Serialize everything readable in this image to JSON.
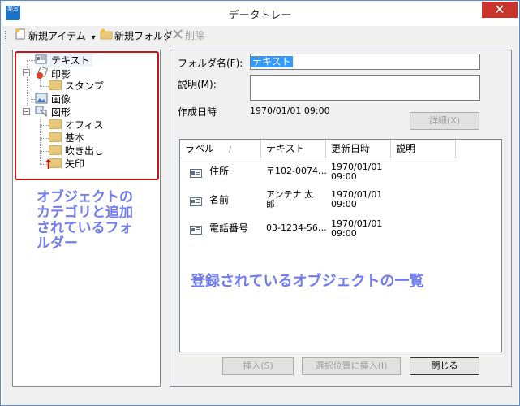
{
  "window": {
    "title": "データトレー",
    "close_glyph": "✕",
    "app_icon_text": "楽写"
  },
  "toolbar": {
    "new_item": "新規アイテム",
    "new_item_dropdown": "▾",
    "new_folder": "新規フォルダ",
    "delete": "削除"
  },
  "tree": {
    "items": [
      {
        "label": "テキスト",
        "icon": "text-icon"
      },
      {
        "label": "印影",
        "icon": "stamp-icon"
      },
      {
        "label": "スタンプ",
        "icon": "folder-icon"
      },
      {
        "label": "画像",
        "icon": "image-icon"
      },
      {
        "label": "図形",
        "icon": "shape-icon"
      },
      {
        "label": "オフィス",
        "icon": "folder-icon"
      },
      {
        "label": "基本",
        "icon": "folder-icon"
      },
      {
        "label": "吹き出し",
        "icon": "folder-icon"
      },
      {
        "label": "矢印",
        "icon": "folder-icon"
      }
    ],
    "expander_minus": "−"
  },
  "annotations": {
    "arrow": "↑",
    "tree_note": "オブジェクトの\nカテゴリと追加\nされているフォ\nルダー",
    "list_note": "登録されているオブジェクトの一覧"
  },
  "details": {
    "folder_name_label": "フォルダ名(F):",
    "folder_name_value": "テキスト",
    "description_label": "説明(M):",
    "description_value": "",
    "created_label": "作成日時",
    "created_value": "1970/01/01 09:00",
    "detail_button": "詳細(X)"
  },
  "list": {
    "columns": [
      "ラベル",
      "テキスト",
      "更新日時",
      "説明"
    ],
    "sort_indicator": "/",
    "rows": [
      {
        "label": "住所",
        "text": "〒102-0074…",
        "updated": "1970/01/01\n09:00",
        "desc": ""
      },
      {
        "label": "名前",
        "text": "アンテナ 太\n郎",
        "updated": "1970/01/01\n09:00",
        "desc": ""
      },
      {
        "label": "電話番号",
        "text": "03-1234-56…",
        "updated": "1970/01/01\n09:00",
        "desc": ""
      }
    ]
  },
  "buttons": {
    "insert": "挿入(S)",
    "insert_at_selection": "選択位置に挿入(I)",
    "close": "閉じる"
  },
  "colors": {
    "annotation": "#6f7bf2",
    "highlight_border": "#cc1414",
    "selection": "#3399ff",
    "close_button": "#c7352b"
  }
}
